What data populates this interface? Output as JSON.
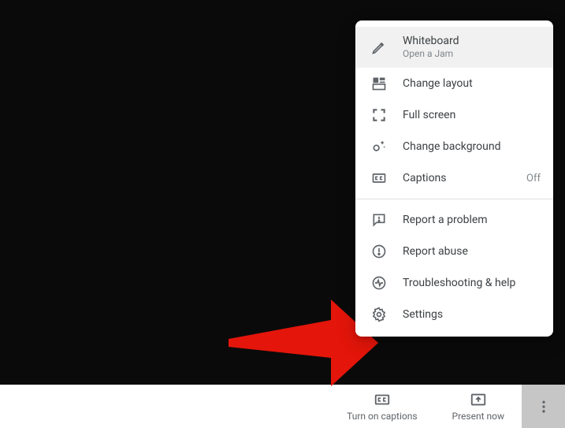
{
  "menu": {
    "items": [
      {
        "label": "Whiteboard",
        "sub": "Open a Jam"
      },
      {
        "label": "Change layout"
      },
      {
        "label": "Full screen"
      },
      {
        "label": "Change background"
      },
      {
        "label": "Captions",
        "badge": "Off"
      }
    ],
    "secondary": [
      {
        "label": "Report a problem"
      },
      {
        "label": "Report abuse"
      },
      {
        "label": "Troubleshooting & help"
      },
      {
        "label": "Settings"
      }
    ]
  },
  "bottom": {
    "captions_label": "Turn on captions",
    "present_label": "Present now"
  }
}
